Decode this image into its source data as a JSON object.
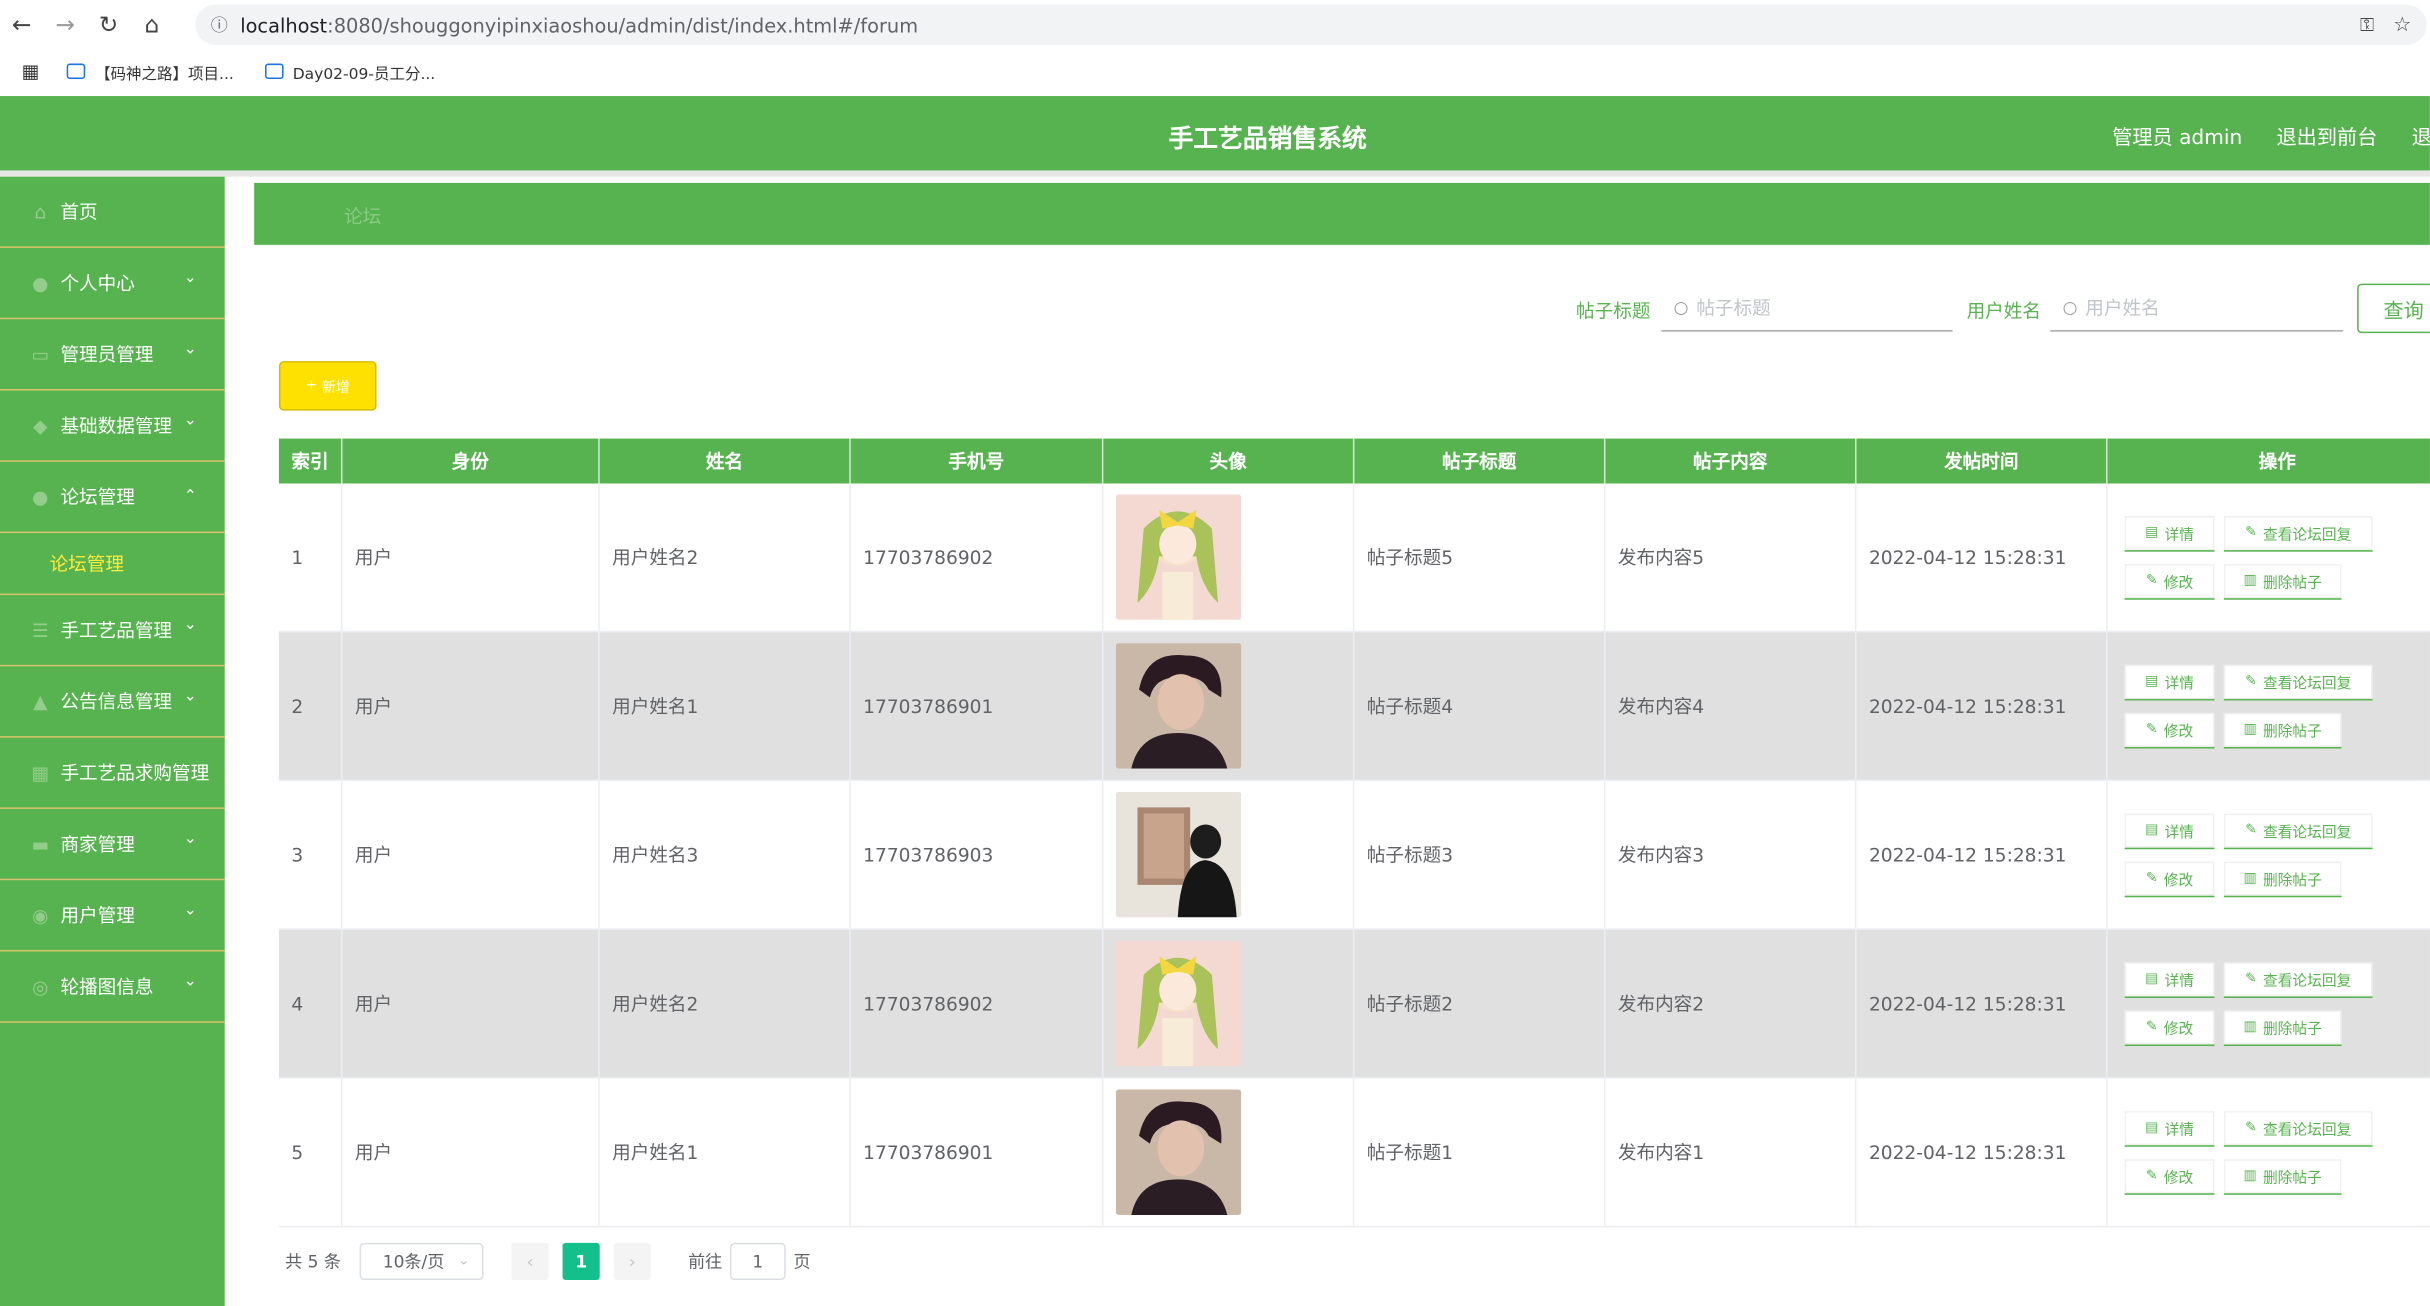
{
  "browser": {
    "url_host": "localhost",
    "url_path": ":8080/shouggonyipinxiaoshou/admin/dist/index.html#/forum",
    "bookmarks": [
      "【码神之路】项目...",
      "Day02-09-员工分..."
    ]
  },
  "header": {
    "title": "手工艺品销售系统",
    "user": "管理员 admin",
    "front_link": "退出到前台",
    "logout": "退出"
  },
  "sidebar": {
    "items": [
      {
        "label": "首页",
        "icon": "home-icon",
        "chevron": false
      },
      {
        "label": "个人中心",
        "icon": "user-icon",
        "chevron": true
      },
      {
        "label": "管理员管理",
        "icon": "admin-icon",
        "chevron": true
      },
      {
        "label": "基础数据管理",
        "icon": "data-icon",
        "chevron": true
      },
      {
        "label": "论坛管理",
        "icon": "forum-icon",
        "chevron": true,
        "open": true,
        "sub": "论坛管理"
      },
      {
        "label": "手工艺品管理",
        "icon": "craft-icon",
        "chevron": true
      },
      {
        "label": "公告信息管理",
        "icon": "notice-icon",
        "chevron": true
      },
      {
        "label": "手工艺品求购管理",
        "icon": "purchase-icon",
        "chevron": false
      },
      {
        "label": "商家管理",
        "icon": "shop-icon",
        "chevron": true
      },
      {
        "label": "用户管理",
        "icon": "users-icon",
        "chevron": true
      },
      {
        "label": "轮播图信息",
        "icon": "carousel-icon",
        "chevron": true
      }
    ]
  },
  "breadcrumb": "论坛",
  "search": {
    "title_label": "帖子标题",
    "title_placeholder": "帖子标题",
    "user_label": "用户姓名",
    "user_placeholder": "用户姓名",
    "query_button": "查询"
  },
  "add_button": "新增",
  "table": {
    "headers": [
      "索引",
      "身份",
      "姓名",
      "手机号",
      "头像",
      "帖子标题",
      "帖子内容",
      "发帖时间",
      "操作"
    ],
    "rows": [
      {
        "index": "1",
        "role": "用户",
        "name": "用户姓名2",
        "phone": "17703786902",
        "avatar": "anime",
        "title": "帖子标题5",
        "content": "发布内容5",
        "time": "2022-04-12 15:28:31"
      },
      {
        "index": "2",
        "role": "用户",
        "name": "用户姓名1",
        "phone": "17703786901",
        "avatar": "man",
        "title": "帖子标题4",
        "content": "发布内容4",
        "time": "2022-04-12 15:28:31"
      },
      {
        "index": "3",
        "role": "用户",
        "name": "用户姓名3",
        "phone": "17703786903",
        "avatar": "painting",
        "title": "帖子标题3",
        "content": "发布内容3",
        "time": "2022-04-12 15:28:31"
      },
      {
        "index": "4",
        "role": "用户",
        "name": "用户姓名2",
        "phone": "17703786902",
        "avatar": "anime",
        "title": "帖子标题2",
        "content": "发布内容2",
        "time": "2022-04-12 15:28:31"
      },
      {
        "index": "5",
        "role": "用户",
        "name": "用户姓名1",
        "phone": "17703786901",
        "avatar": "man",
        "title": "帖子标题1",
        "content": "发布内容1",
        "time": "2022-04-12 15:28:31"
      }
    ],
    "actions": {
      "detail": "详情",
      "reply": "查看论坛回复",
      "edit": "修改",
      "delete": "删除帖子"
    }
  },
  "pagination": {
    "total": "共 5 条",
    "page_size": "10条/页",
    "current": "1",
    "goto_prefix": "前往",
    "goto_value": "1",
    "goto_suffix": "页"
  },
  "colors": {
    "primary": "#57b34f",
    "add": "#ffe100",
    "page_active": "#13c08c",
    "submenu_active": "#ffeb3b"
  }
}
